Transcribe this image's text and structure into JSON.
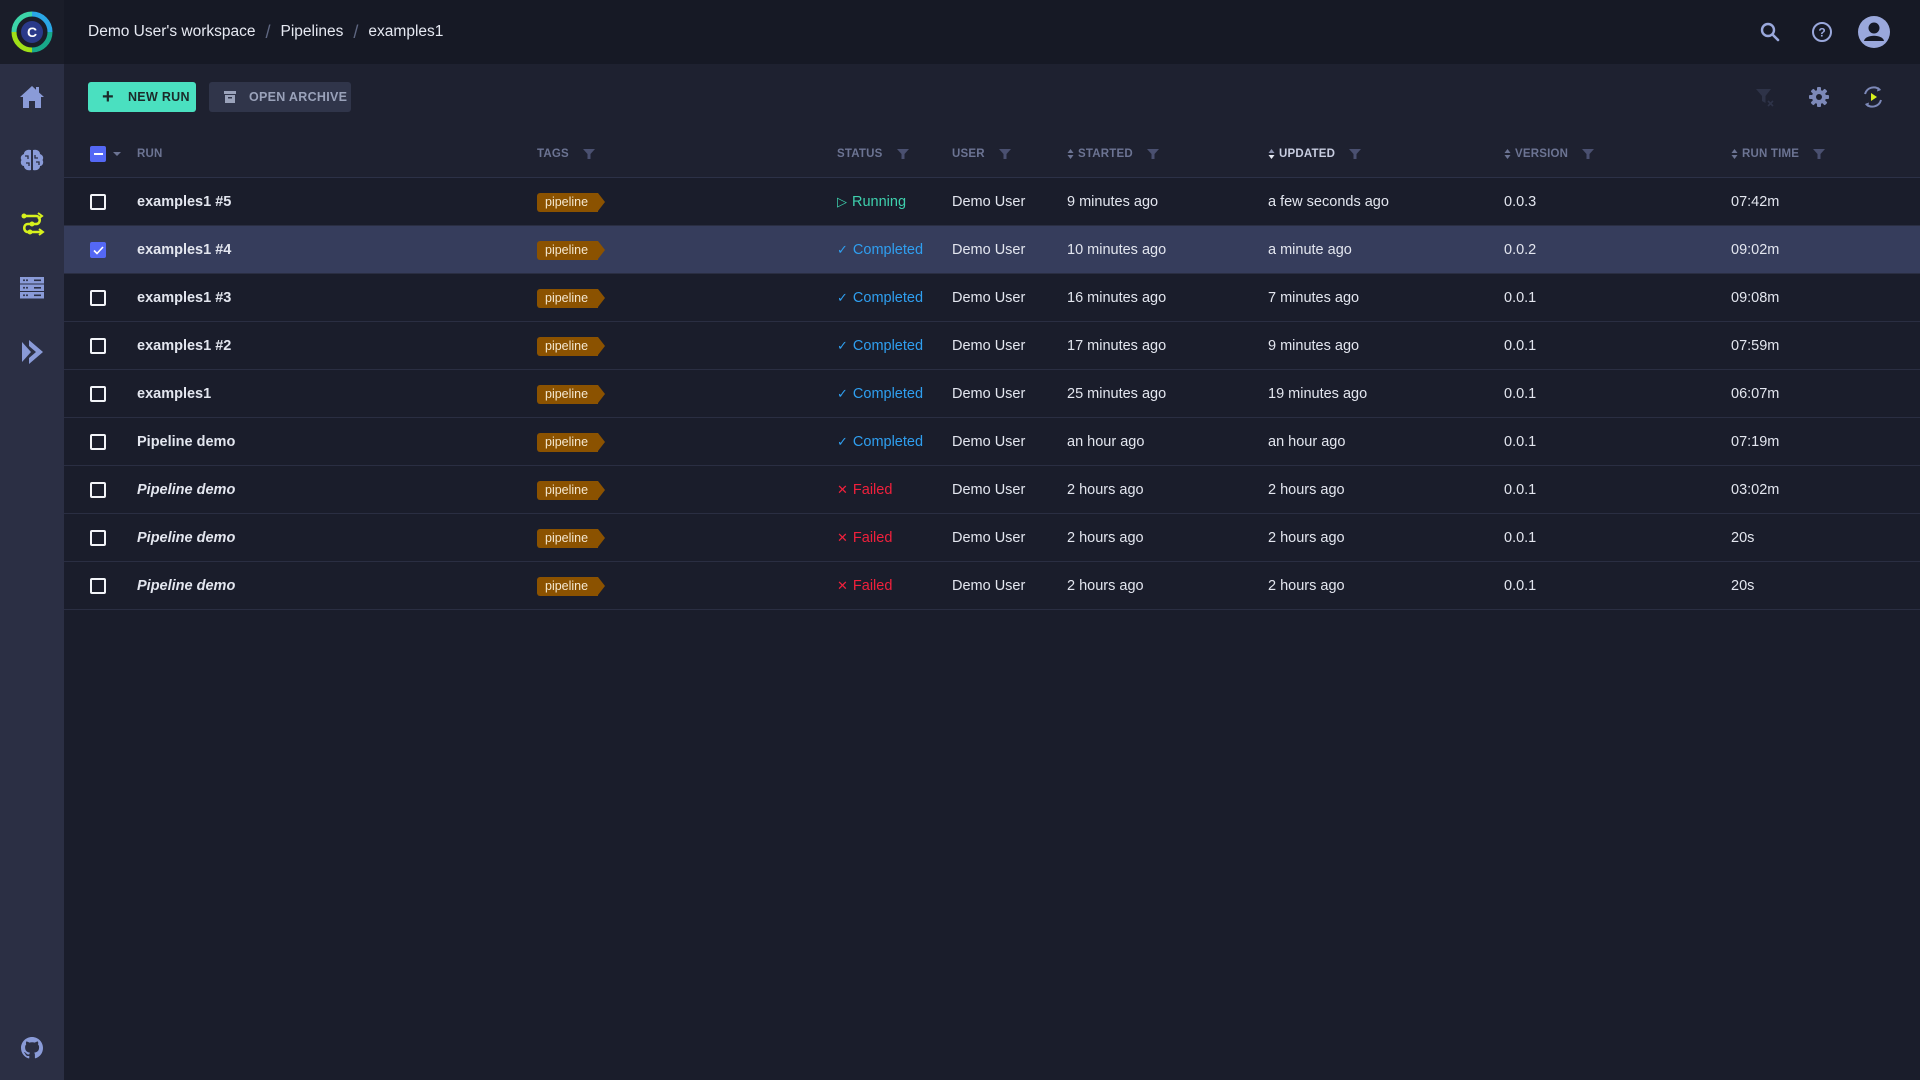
{
  "app": {
    "logo_letter": "C",
    "colors": {
      "accent": "#4ae0c0",
      "nav_active": "#d7f11d",
      "selected_row": "#363d5c",
      "tag_bg": "#8b5200",
      "running": "#3ed0ad",
      "completed": "#2f9ff0",
      "failed": "#f0203c",
      "checkbox": "#5468f5"
    }
  },
  "sidebar": {
    "items": [
      {
        "icon": "home-icon",
        "label": "Home",
        "active": false
      },
      {
        "icon": "brain-icon",
        "label": "Projects",
        "active": false
      },
      {
        "icon": "pipelines-icon",
        "label": "Pipelines",
        "active": true
      },
      {
        "icon": "datasets-icon",
        "label": "Datasets",
        "active": false
      },
      {
        "icon": "orchestration-icon",
        "label": "Orchestration",
        "active": false
      }
    ],
    "bottom_icon": "github-icon"
  },
  "topbar": {
    "breadcrumb": [
      "Demo User's workspace",
      "Pipelines",
      "examples1"
    ],
    "separator": "/",
    "icons": [
      "search-icon",
      "help-icon",
      "user-avatar-icon"
    ]
  },
  "toolbar": {
    "new_run_label": "NEW RUN",
    "open_archive_label": "OPEN ARCHIVE",
    "icons": [
      "clear-filters-icon",
      "settings-icon",
      "auto-refresh-icon"
    ]
  },
  "table": {
    "columns": {
      "run": "RUN",
      "tags": "TAGS",
      "status": "STATUS",
      "user": "USER",
      "started": "STARTED",
      "updated": "UPDATED",
      "version": "VERSION",
      "runtime": "RUN TIME"
    },
    "sorted_by": "UPDATED",
    "rows": [
      {
        "name": "examples1 #5",
        "italic": false,
        "selected": false,
        "tag": "pipeline",
        "status": "Running",
        "status_glyph": "▷",
        "status_class": "st-running",
        "user": "Demo User",
        "started": "9 minutes ago",
        "updated": "a few seconds ago",
        "version": "0.0.3",
        "runtime": "07:42m"
      },
      {
        "name": "examples1 #4",
        "italic": false,
        "selected": true,
        "tag": "pipeline",
        "status": "Completed",
        "status_glyph": "✓",
        "status_class": "st-completed",
        "user": "Demo User",
        "started": "10 minutes ago",
        "updated": "a minute ago",
        "version": "0.0.2",
        "runtime": "09:02m"
      },
      {
        "name": "examples1 #3",
        "italic": false,
        "selected": false,
        "tag": "pipeline",
        "status": "Completed",
        "status_glyph": "✓",
        "status_class": "st-completed",
        "user": "Demo User",
        "started": "16 minutes ago",
        "updated": "7 minutes ago",
        "version": "0.0.1",
        "runtime": "09:08m"
      },
      {
        "name": "examples1 #2",
        "italic": false,
        "selected": false,
        "tag": "pipeline",
        "status": "Completed",
        "status_glyph": "✓",
        "status_class": "st-completed",
        "user": "Demo User",
        "started": "17 minutes ago",
        "updated": "9 minutes ago",
        "version": "0.0.1",
        "runtime": "07:59m"
      },
      {
        "name": "examples1",
        "italic": false,
        "selected": false,
        "tag": "pipeline",
        "status": "Completed",
        "status_glyph": "✓",
        "status_class": "st-completed",
        "user": "Demo User",
        "started": "25 minutes ago",
        "updated": "19 minutes ago",
        "version": "0.0.1",
        "runtime": "06:07m"
      },
      {
        "name": "Pipeline demo",
        "italic": false,
        "selected": false,
        "tag": "pipeline",
        "status": "Completed",
        "status_glyph": "✓",
        "status_class": "st-completed",
        "user": "Demo User",
        "started": "an hour ago",
        "updated": "an hour ago",
        "version": "0.0.1",
        "runtime": "07:19m"
      },
      {
        "name": "Pipeline demo",
        "italic": true,
        "selected": false,
        "tag": "pipeline",
        "status": "Failed",
        "status_glyph": "✕",
        "status_class": "st-failed",
        "user": "Demo User",
        "started": "2 hours ago",
        "updated": "2 hours ago",
        "version": "0.0.1",
        "runtime": "03:02m"
      },
      {
        "name": "Pipeline demo",
        "italic": true,
        "selected": false,
        "tag": "pipeline",
        "status": "Failed",
        "status_glyph": "✕",
        "status_class": "st-failed",
        "user": "Demo User",
        "started": "2 hours ago",
        "updated": "2 hours ago",
        "version": "0.0.1",
        "runtime": "20s"
      },
      {
        "name": "Pipeline demo",
        "italic": true,
        "selected": false,
        "tag": "pipeline",
        "status": "Failed",
        "status_glyph": "✕",
        "status_class": "st-failed",
        "user": "Demo User",
        "started": "2 hours ago",
        "updated": "2 hours ago",
        "version": "0.0.1",
        "runtime": "20s"
      }
    ]
  }
}
